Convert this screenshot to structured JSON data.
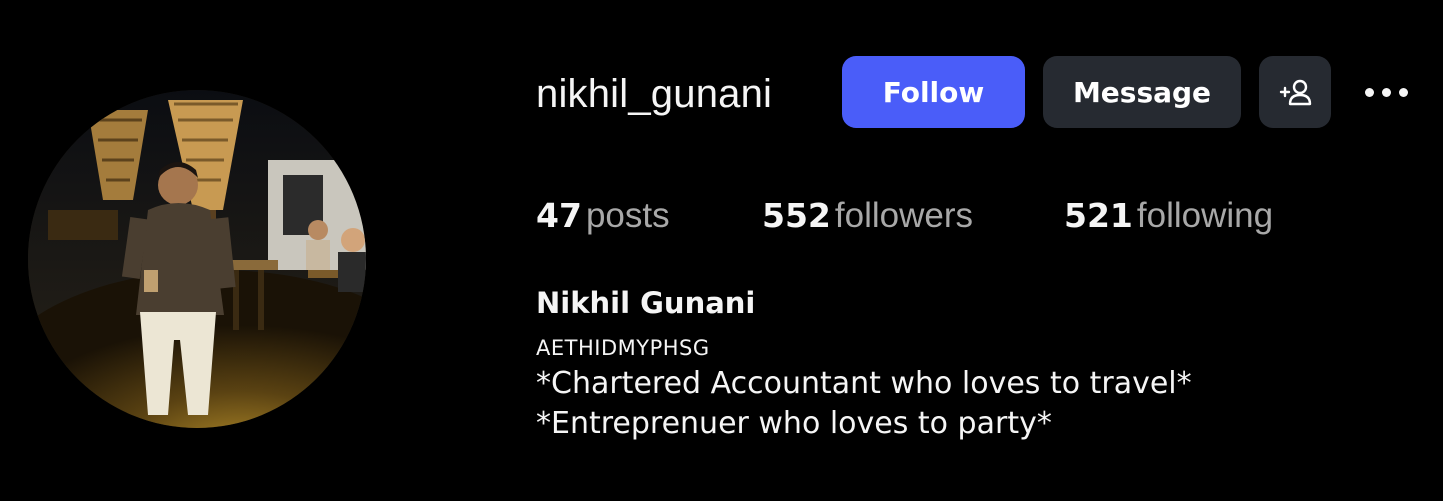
{
  "profile": {
    "username": "nikhil_gunani",
    "full_name": "Nikhil Gunani",
    "category": "AETHIDMYPHSG",
    "bio": [
      "*Chartered Accountant who loves to travel*",
      "*Entreprenuer who loves to party*"
    ],
    "avatar_icon": "profile-photo"
  },
  "actions": {
    "follow_label": "Follow",
    "message_label": "Message",
    "suggest_icon": "add-person-icon",
    "more_icon": "more-options-icon"
  },
  "stats": {
    "posts": {
      "value": "47",
      "label": "posts"
    },
    "followers": {
      "value": "552",
      "label": "followers"
    },
    "following": {
      "value": "521",
      "label": "following"
    }
  },
  "colors": {
    "background": "#000000",
    "follow_button": "#4a5df9",
    "secondary_button": "#262a31",
    "primary_text": "#f5f5f5",
    "secondary_text": "#a8a8a8"
  }
}
